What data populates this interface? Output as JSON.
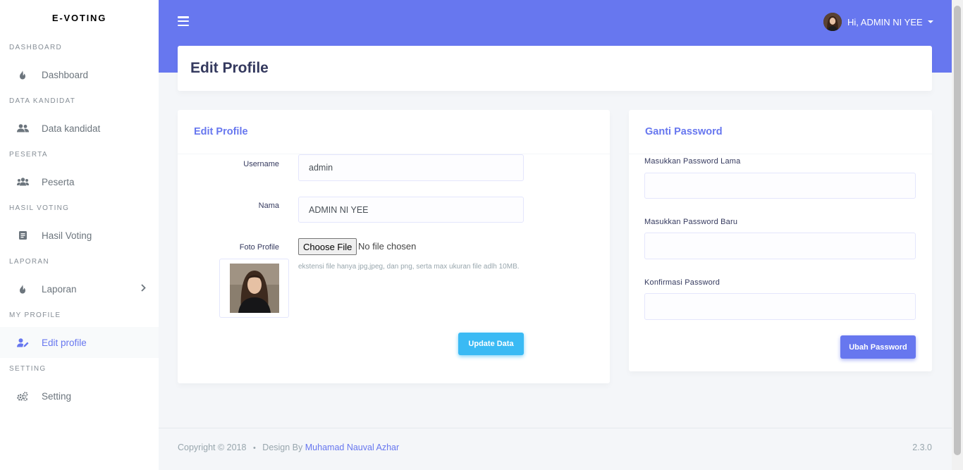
{
  "brand": "E-VOTING",
  "sidebar": {
    "sections": [
      {
        "header": "DASHBOARD",
        "item": "Dashboard",
        "icon": "fire-icon"
      },
      {
        "header": "DATA KANDIDAT",
        "item": "Data kandidat",
        "icon": "users-icon"
      },
      {
        "header": "PESERTA",
        "item": "Peserta",
        "icon": "users-group-icon"
      },
      {
        "header": "HASIL VOTING",
        "item": "Hasil Voting",
        "icon": "document-icon"
      },
      {
        "header": "LAPORAN",
        "item": "Laporan",
        "icon": "fire-icon"
      },
      {
        "header": "MY PROFILE",
        "item": "Edit profile",
        "icon": "user-edit-icon"
      },
      {
        "header": "SETTING",
        "item": "Setting",
        "icon": "cogs-icon"
      }
    ]
  },
  "topbar": {
    "user_greeting": "Hi, ADMIN NI YEE"
  },
  "page_title": "Edit Profile",
  "profile_card": {
    "title": "Edit Profile",
    "username_label": "Username",
    "username_value": "admin",
    "nama_label": "Nama",
    "nama_value": "ADMIN NI YEE",
    "foto_label": "Foto Profile",
    "file_button": "Choose File",
    "file_status": "No file chosen",
    "help_text": "ekstensi file hanya jpg,jpeg, dan png, serta max ukuran file adlh 10MB.",
    "submit": "Update Data"
  },
  "password_card": {
    "title": "Ganti Password",
    "old_label": "Masukkan Password Lama",
    "new_label": "Masukkan Password Baru",
    "confirm_label": "Konfirmasi Password",
    "submit": "Ubah Password"
  },
  "footer": {
    "copyright": "Copyright © 2018",
    "separator": "•",
    "design_by": "Design By",
    "author": "Muhamad Nauval Azhar",
    "version": "2.3.0"
  },
  "colors": {
    "primary": "#6777ef",
    "info": "#3abaf4",
    "background": "#f4f6f9"
  }
}
